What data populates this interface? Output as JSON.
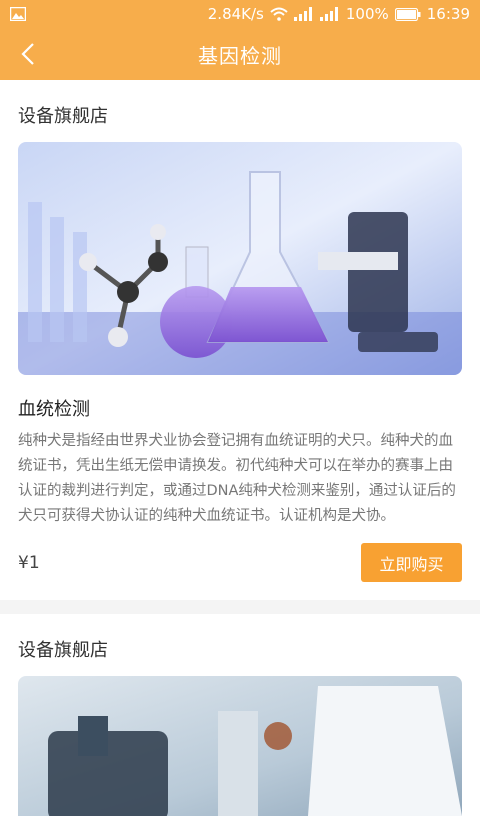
{
  "status_bar": {
    "speed": "2.84K/s",
    "battery": "100%",
    "time": "16:39"
  },
  "header": {
    "title": "基因检测"
  },
  "listings": [
    {
      "store": "设备旗舰店",
      "title": "血统检测",
      "description": "纯种犬是指经由世界犬业协会登记拥有血统证明的犬只。纯种犬的血统证书，凭出生纸无偿申请换发。初代纯种犬可以在举办的赛事上由认证的裁判进行判定，或通过DNA纯种犬检测来鉴别，通过认证后的犬只可获得犬协认证的纯种犬血统证书。认证机构是犬协。",
      "price": "¥1",
      "buy_label": "立即购买"
    },
    {
      "store": "设备旗舰店"
    }
  ],
  "colors": {
    "brand": "#f7ad4b",
    "button": "#f8a132"
  }
}
